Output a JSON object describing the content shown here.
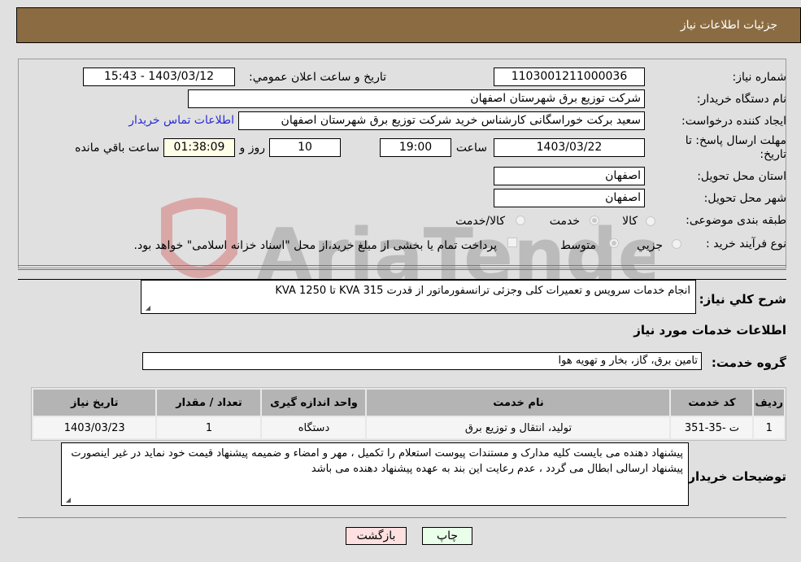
{
  "header": {
    "title": "جزئیات اطلاعات نیاز"
  },
  "form": {
    "need_number": {
      "label": "شماره نیاز:",
      "value": "1103001211000036"
    },
    "announce_datetime": {
      "label": "تاریخ و ساعت اعلان عمومي:",
      "value": "1403/03/12 - 15:43"
    },
    "buyer_org": {
      "label": "نام دستگاه خریدار:",
      "value": "شرکت توزیع برق شهرستان اصفهان"
    },
    "requester": {
      "label": "ایجاد کننده درخواست:",
      "value": "سعید برکت خوراسگانی کارشناس خرید شرکت توزیع برق شهرستان اصفهان"
    },
    "buyer_contact_link": "اطلاعات تماس خریدار",
    "deadline": {
      "label_line1": "مهلت ارسال پاسخ: تا",
      "label_line2": "تاریخ:",
      "date": "1403/03/22",
      "time_label": "ساعت",
      "time": "19:00",
      "days": "10",
      "days_label": "روز و",
      "remaining": "01:38:09",
      "remaining_label": "ساعت باقي مانده"
    },
    "province": {
      "label": "استان محل تحویل:",
      "value": "اصفهان"
    },
    "city": {
      "label": "شهر محل تحویل:",
      "value": "اصفهان"
    },
    "category": {
      "label": "طبقه بندی موضوعی:",
      "options": [
        "کالا",
        "خدمت",
        "کالا/خدمت"
      ],
      "selected": "خدمت"
    },
    "purchase_type": {
      "label": "نوع فرآیند خرید :",
      "options": [
        "جزيي",
        "متوسط"
      ],
      "selected": "متوسط",
      "treasury_note": "پرداخت تمام یا بخشی از مبلغ خرید،از محل \"اسناد خزانه اسلامی\" خواهد بود."
    }
  },
  "description": {
    "label": "شرح كلي نياز:",
    "value": "انجام خدمات سرویس و تعمیرات کلی وجزئی ترانسفورماتور از قدرت 315 KVA تا 1250 KVA"
  },
  "services_section": {
    "title": "اطلاعات خدمات مورد نیاز",
    "group_label": "گروه خدمت:",
    "group_value": "تامین برق، گاز، بخار و تهویه هوا"
  },
  "table": {
    "columns": [
      "ردیف",
      "کد خدمت",
      "نام خدمت",
      "واحد اندازه گیری",
      "تعداد / مقدار",
      "تاریخ نیاز"
    ],
    "rows": [
      {
        "row": "1",
        "code": "ت -35-351",
        "name": "تولید، انتقال و توزیع برق",
        "unit": "دستگاه",
        "qty": "1",
        "date": "1403/03/23"
      }
    ]
  },
  "buyer_notes": {
    "label": "توضیحات خریدار:",
    "value": "پیشنهاد دهنده می بایست کلیه مدارک و مستندات پیوست استعلام را تکمیل ، مهر و امضاء و ضمیمه پیشنهاد قیمت خود نماید در غیر اینصورت پیشنهاد ارسالی ابطال می گردد ، عدم رعایت این بند به عهده پیشنهاد دهنده می باشد"
  },
  "buttons": {
    "print": "چاپ",
    "back": "بازگشت"
  },
  "watermark": {
    "text": "AriaTender.neT"
  },
  "colors": {
    "header_bg": "#8b6c42",
    "link": "#2a2ad8",
    "print_bg": "#eaffea",
    "back_bg": "#ffe0e0",
    "remaining_bg": "#ffffe8"
  }
}
